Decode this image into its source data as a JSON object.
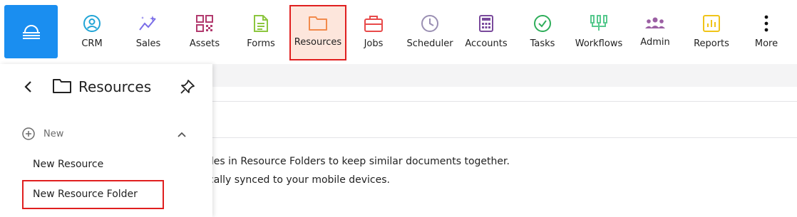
{
  "nav": {
    "items": [
      {
        "label": "CRM",
        "icon": "crm-icon",
        "color": "#22a5d6"
      },
      {
        "label": "Sales",
        "icon": "sales-icon",
        "color": "#7b6ee8"
      },
      {
        "label": "Assets",
        "icon": "assets-icon",
        "color": "#b23a6e"
      },
      {
        "label": "Forms",
        "icon": "forms-icon",
        "color": "#8cc63f"
      },
      {
        "label": "Resources",
        "icon": "folder-icon",
        "color": "#f28a4c"
      },
      {
        "label": "Jobs",
        "icon": "briefcase-icon",
        "color": "#e84a4a"
      },
      {
        "label": "Scheduler",
        "icon": "clock-icon",
        "color": "#9a8fb3"
      },
      {
        "label": "Accounts",
        "icon": "calculator-icon",
        "color": "#7a4a9c"
      },
      {
        "label": "Tasks",
        "icon": "check-circle-icon",
        "color": "#2eae5a"
      },
      {
        "label": "Workflows",
        "icon": "workflow-icon",
        "color": "#57c98e"
      },
      {
        "label": "Admin",
        "icon": "users-icon",
        "color": "#9b5fa3"
      },
      {
        "label": "Reports",
        "icon": "chart-icon",
        "color": "#f0c419"
      },
      {
        "label": "More",
        "icon": "more-icon",
        "color": "#111111"
      }
    ]
  },
  "panel": {
    "title": "Resources",
    "section_label": "New",
    "items": [
      "New Resource",
      "New Resource Folder"
    ]
  },
  "main": {
    "line1": "iles in Resource Folders to keep similar documents together.",
    "line2": "cally synced to your mobile devices."
  }
}
